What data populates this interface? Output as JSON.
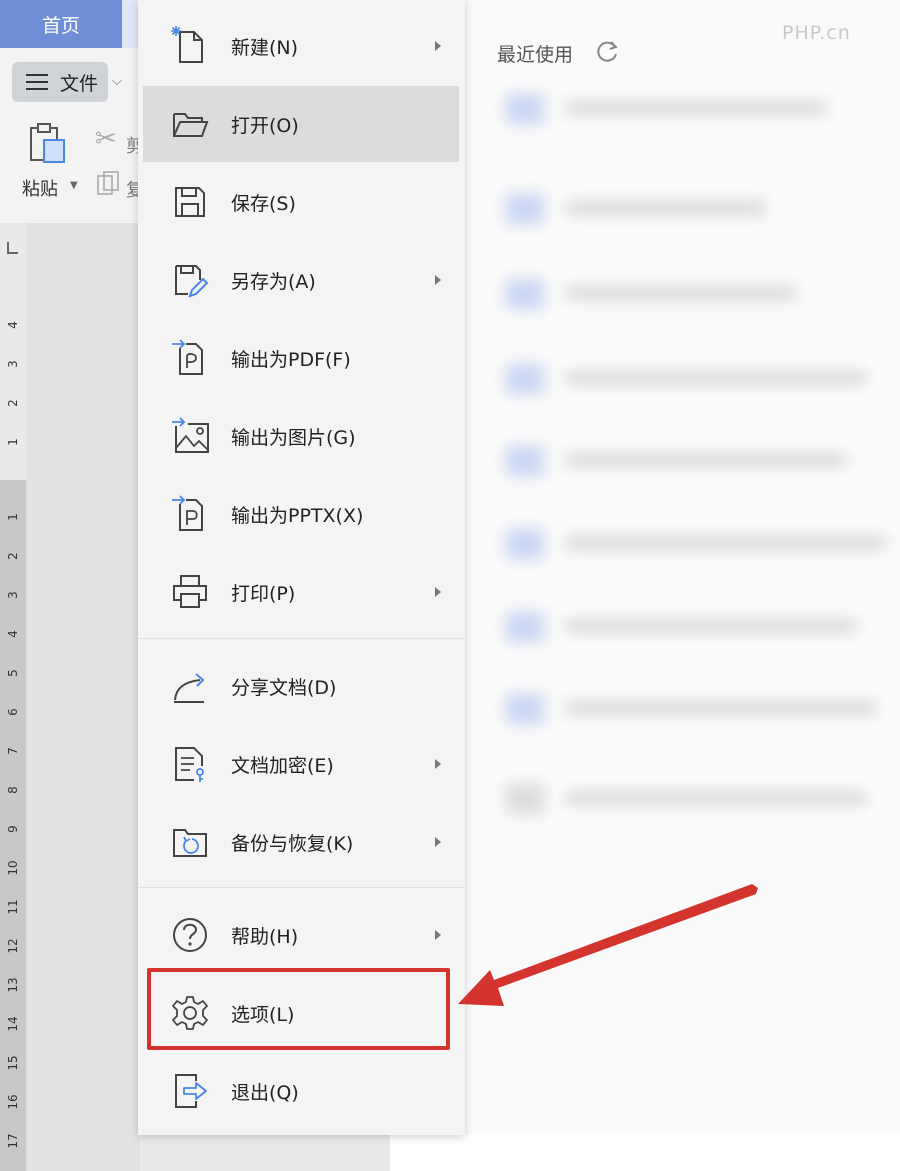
{
  "app": {
    "home_tab": "首页",
    "file_menu_button": "文件",
    "paste_label": "粘贴",
    "cut_partial": "剪",
    "copy_partial": "复"
  },
  "ruler": {
    "top_numbers": [
      "4",
      "3",
      "2",
      "1"
    ],
    "bottom_numbers": [
      "1",
      "2",
      "3",
      "4",
      "5",
      "6",
      "7",
      "8",
      "9",
      "10",
      "11",
      "12",
      "13",
      "14",
      "15",
      "16",
      "17"
    ]
  },
  "file_menu": {
    "items": [
      {
        "label": "新建(N)",
        "icon": "new-file-icon",
        "submenu": true
      },
      {
        "label": "打开(O)",
        "icon": "open-folder-icon",
        "submenu": false,
        "highlighted": true
      },
      {
        "label": "保存(S)",
        "icon": "save-icon",
        "submenu": false
      },
      {
        "label": "另存为(A)",
        "icon": "save-as-icon",
        "submenu": true
      },
      {
        "label": "输出为PDF(F)",
        "icon": "export-pdf-icon",
        "submenu": false
      },
      {
        "label": "输出为图片(G)",
        "icon": "export-image-icon",
        "submenu": false
      },
      {
        "label": "输出为PPTX(X)",
        "icon": "export-pptx-icon",
        "submenu": false
      },
      {
        "label": "打印(P)",
        "icon": "print-icon",
        "submenu": true
      },
      {
        "label": "分享文档(D)",
        "icon": "share-icon",
        "submenu": false
      },
      {
        "label": "文档加密(E)",
        "icon": "encrypt-icon",
        "submenu": true
      },
      {
        "label": "备份与恢复(K)",
        "icon": "backup-restore-icon",
        "submenu": true
      },
      {
        "label": "帮助(H)",
        "icon": "help-icon",
        "submenu": true
      },
      {
        "label": "选项(L)",
        "icon": "gear-icon",
        "submenu": false,
        "annotated": true
      },
      {
        "label": "退出(Q)",
        "icon": "exit-icon",
        "submenu": false
      }
    ]
  },
  "recent": {
    "title": "最近使用",
    "refresh_icon": "refresh-icon"
  },
  "watermark": "PHP.cn",
  "colors": {
    "accent": "#6e8fd6",
    "annotation_red": "#d4342e",
    "highlight": "#dcdcdc"
  }
}
